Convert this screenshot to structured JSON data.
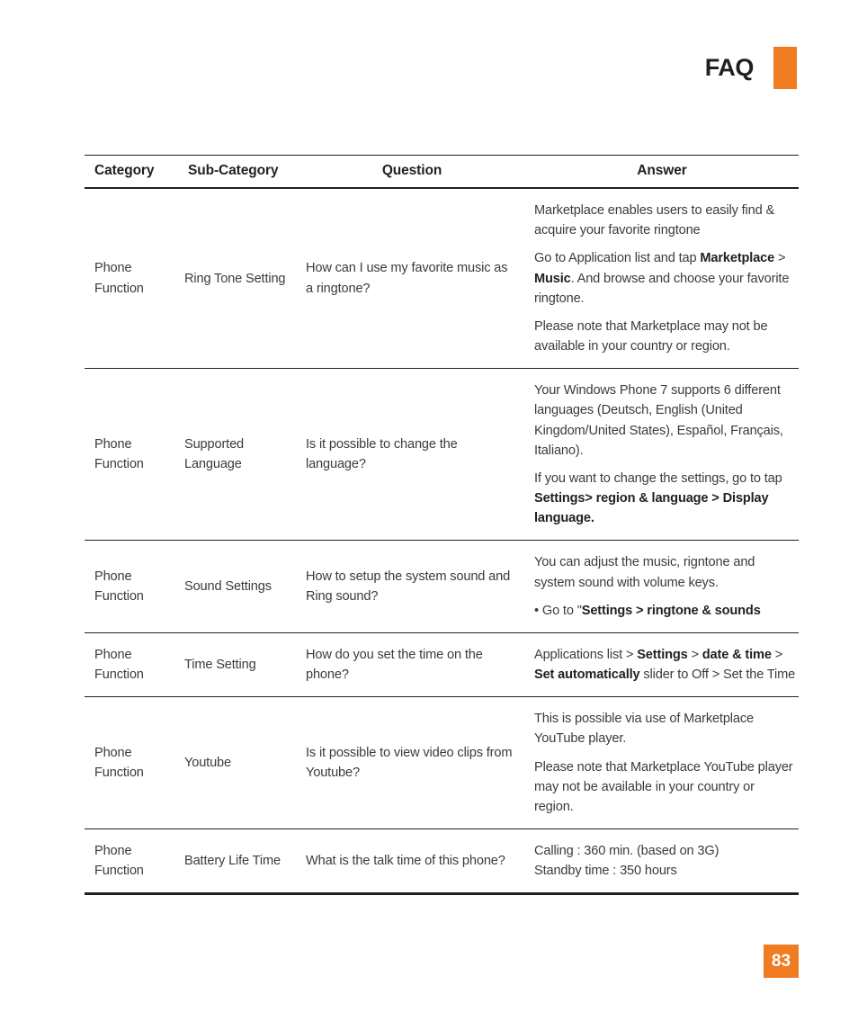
{
  "header": {
    "title": "FAQ",
    "accent_color": "#ef7c22"
  },
  "table": {
    "columns": [
      "Category",
      "Sub-Category",
      "Question",
      "Answer"
    ],
    "rows": [
      {
        "category": "Phone\nFunction",
        "subcategory": "Ring Tone Setting",
        "question": "How can I use my favorite music as a ringtone?",
        "answer_paragraphs": [
          [
            {
              "t": "Marketplace enables users to easily find & acquire your favorite ringtone",
              "b": false
            }
          ],
          [
            {
              "t": "Go to Application list and tap ",
              "b": false
            },
            {
              "t": "Marketplace",
              "b": true
            },
            {
              "t": " > ",
              "b": false
            },
            {
              "t": "Music",
              "b": true
            },
            {
              "t": ". And browse and choose your favorite ringtone.",
              "b": false
            }
          ],
          [
            {
              "t": "Please note that Marketplace may not be available in your country or region.",
              "b": false
            }
          ]
        ]
      },
      {
        "category": "Phone\nFunction",
        "subcategory": "Supported Language",
        "question": "Is it possible to change the language?",
        "answer_paragraphs": [
          [
            {
              "t": "Your Windows Phone 7 supports 6 different languages (Deutsch, English (United Kingdom/United States), Español, Français, Italiano).",
              "b": false
            }
          ],
          [
            {
              "t": "If you want to change the settings, go to tap ",
              "b": false
            },
            {
              "t": "Settings> region & language > Display language.",
              "b": true
            }
          ]
        ]
      },
      {
        "category": "Phone\nFunction",
        "subcategory": "Sound Settings",
        "question": "How to setup the system sound and Ring sound?",
        "answer_paragraphs": [
          [
            {
              "t": "You can adjust the music, rigntone and system sound with volume keys.",
              "b": false
            }
          ],
          [
            {
              "t": "• Go to \"",
              "b": false
            },
            {
              "t": "Settings > ringtone & sounds",
              "b": true
            }
          ]
        ]
      },
      {
        "category": "Phone\nFunction",
        "subcategory": "Time Setting",
        "question": "How do you set the time on the phone?",
        "answer_paragraphs": [
          [
            {
              "t": "Applications list > ",
              "b": false
            },
            {
              "t": "Settings",
              "b": true
            },
            {
              "t": " > ",
              "b": false
            },
            {
              "t": "date & time",
              "b": true
            },
            {
              "t": " > ",
              "b": false
            },
            {
              "t": "Set automatically",
              "b": true
            },
            {
              "t": " slider to Off > Set the Time",
              "b": false
            }
          ]
        ]
      },
      {
        "category": "Phone\nFunction",
        "subcategory": "Youtube",
        "question": "Is it possible to view video clips from Youtube?",
        "answer_paragraphs": [
          [
            {
              "t": "This is possible via use of Marketplace YouTube player.",
              "b": false
            }
          ],
          [
            {
              "t": "Please note that Marketplace YouTube player may not be available in your country or region.",
              "b": false
            }
          ]
        ]
      },
      {
        "category": "Phone\nFunction",
        "subcategory": "Battery Life Time",
        "question": "What is the talk time of this phone?",
        "answer_paragraphs": [
          [
            {
              "t": "Calling : 360 min. (based on 3G)\nStandby time : 350 hours",
              "b": false
            }
          ]
        ]
      }
    ]
  },
  "footer": {
    "page_number": "83",
    "accent_color": "#ef7c22"
  }
}
